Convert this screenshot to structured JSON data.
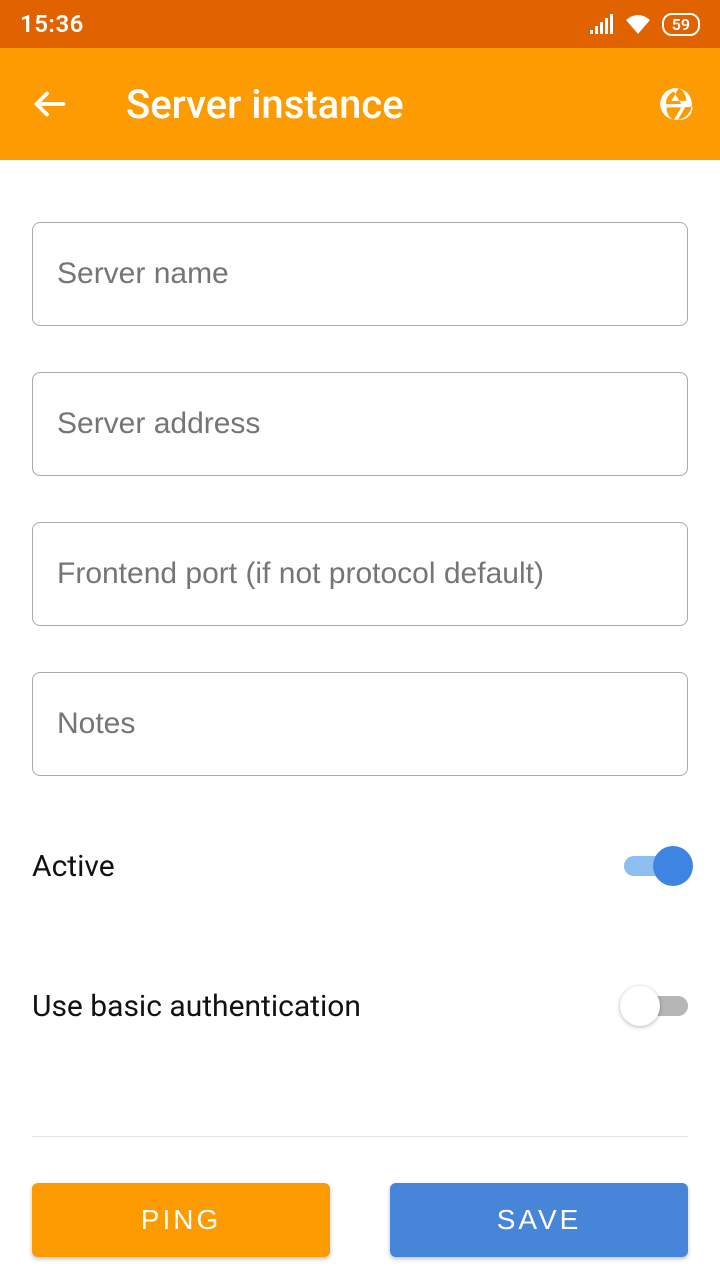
{
  "statusbar": {
    "time": "15:36",
    "battery": "59"
  },
  "header": {
    "title": "Server instance"
  },
  "form": {
    "server_name": {
      "placeholder": "Server name",
      "value": ""
    },
    "server_address": {
      "placeholder": "Server address",
      "value": ""
    },
    "frontend_port": {
      "placeholder": "Frontend port (if not protocol default)",
      "value": ""
    },
    "notes": {
      "placeholder": "Notes",
      "value": ""
    }
  },
  "toggles": {
    "active": {
      "label": "Active",
      "value": true
    },
    "basic_auth": {
      "label": "Use basic authentication",
      "value": false
    }
  },
  "buttons": {
    "ping": "PING",
    "save": "SAVE"
  }
}
